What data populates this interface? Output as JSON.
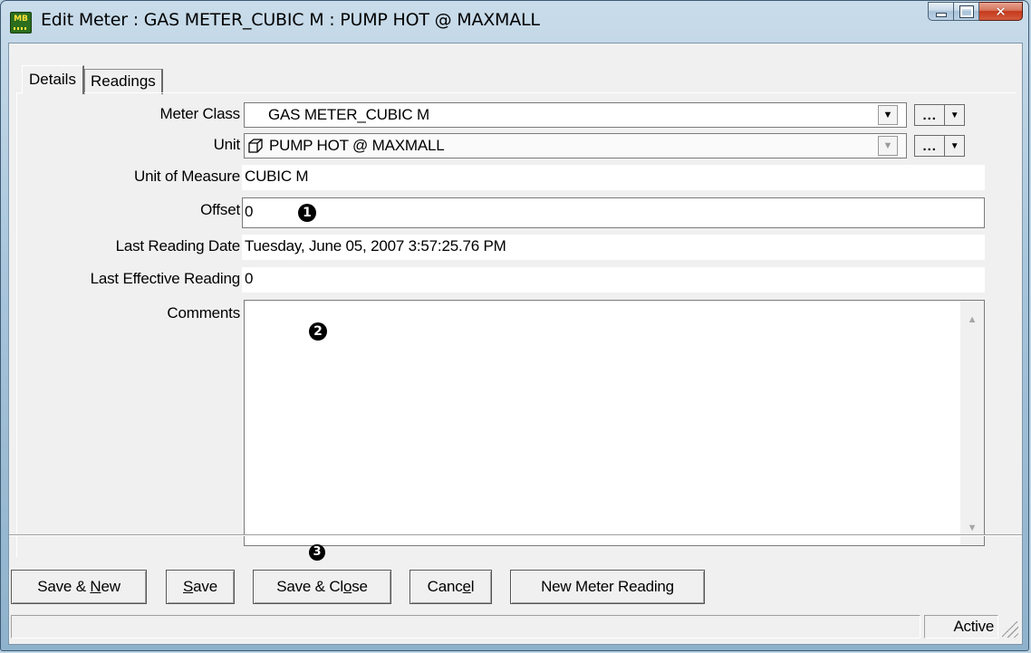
{
  "window": {
    "title": "Edit Meter : GAS METER_CUBIC M : PUMP HOT @ MAXMALL",
    "app_icon_text": "MB"
  },
  "tabs": [
    {
      "label": "Details",
      "active": true
    },
    {
      "label": "Readings",
      "active": false
    }
  ],
  "form": {
    "meter_class": {
      "label": "Meter Class",
      "value": "GAS METER_CUBIC M"
    },
    "unit": {
      "label": "Unit",
      "value": "PUMP HOT @ MAXMALL"
    },
    "unit_of_measure": {
      "label": "Unit of Measure",
      "value": "CUBIC M"
    },
    "offset": {
      "label": "Offset",
      "value": "0"
    },
    "last_reading_date": {
      "label": "Last Reading Date",
      "value": "Tuesday, June 05, 2007 3:57:25.76 PM"
    },
    "last_effective_reading": {
      "label": "Last Effective Reading",
      "value": "0"
    },
    "comments": {
      "label": "Comments",
      "value": ""
    },
    "ellipsis_label": "..."
  },
  "callouts": [
    "1",
    "2",
    "3"
  ],
  "buttons": {
    "save_new": {
      "pre": "Save & ",
      "accel": "N",
      "post": "ew"
    },
    "save": {
      "pre": "",
      "accel": "S",
      "post": "ave"
    },
    "save_close": {
      "pre": "Save & Cl",
      "accel": "o",
      "post": "se"
    },
    "cancel": {
      "pre": "Canc",
      "accel": "e",
      "post": "l"
    },
    "new_meter_reading": "New Meter Reading"
  },
  "status": {
    "message": "",
    "state": "Active"
  }
}
